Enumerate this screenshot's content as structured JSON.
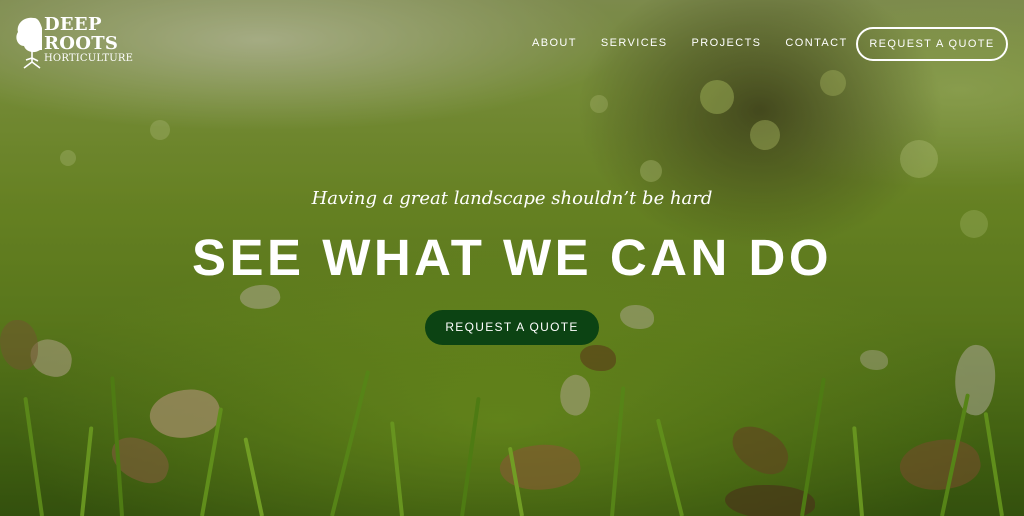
{
  "brand": {
    "line1": "DEEP",
    "line2": "ROOTS",
    "line3": "HORTICULTURE",
    "logo_icon": "tree-icon"
  },
  "nav": {
    "items": [
      {
        "label": "ABOUT"
      },
      {
        "label": "SERVICES"
      },
      {
        "label": "PROJECTS"
      },
      {
        "label": "CONTACT"
      }
    ],
    "cta_label": "REQUEST A QUOTE"
  },
  "hero": {
    "tagline": "Having a great landscape shouldn’t be hard",
    "headline": "SEE WHAT WE CAN DO",
    "cta_label": "REQUEST A QUOTE"
  },
  "colors": {
    "cta_background": "#0c4313",
    "text": "#ffffff"
  }
}
